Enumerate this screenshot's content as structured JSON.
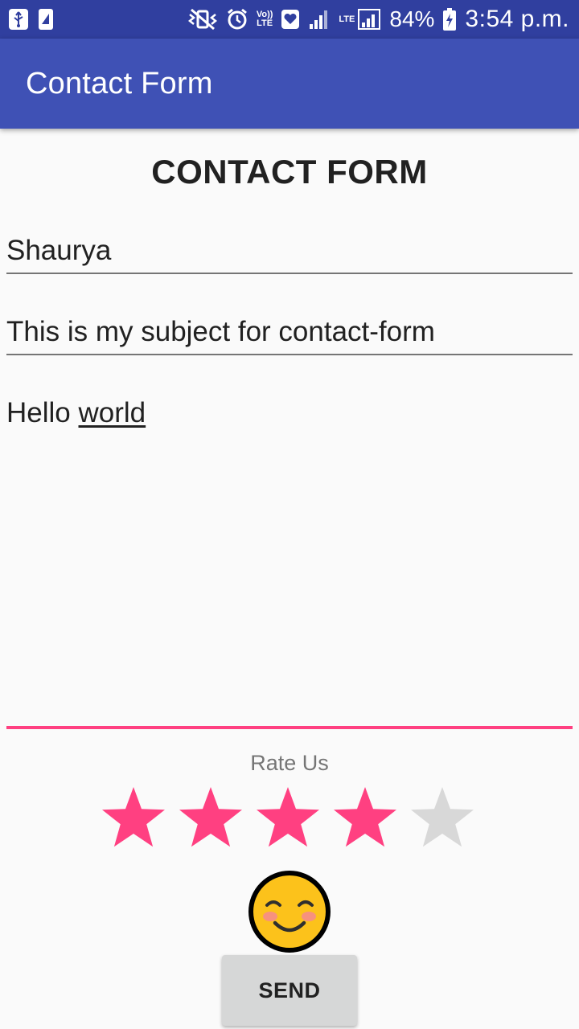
{
  "status_bar": {
    "battery_percent": "84%",
    "time": "3:54 p.m.",
    "volte_label_top": "Vo))",
    "volte_label_bottom": "LTE",
    "lte_label": "LTE",
    "icons": [
      "usb-icon",
      "sim-icon",
      "vibrate-icon",
      "alarm-icon",
      "volte-icon",
      "heart-icon",
      "signal-icon",
      "lte-signal-icon",
      "battery-charging-icon"
    ]
  },
  "app_bar": {
    "title": "Contact Form"
  },
  "form": {
    "heading": "CONTACT FORM",
    "name_value": "Shaurya",
    "subject_value": "This is my subject for contact-form",
    "message_first": "Hello",
    "message_second": "world"
  },
  "rating": {
    "label": "Rate Us",
    "value": 4,
    "max": 5,
    "filled_color": "#ff4081",
    "empty_color": "#d8d8d8",
    "emoji": "smiling-face-icon"
  },
  "send_button": {
    "label": "SEND"
  },
  "colors": {
    "status_bar": "#303f9f",
    "app_bar": "#3f51b5",
    "accent": "#ff4081"
  }
}
